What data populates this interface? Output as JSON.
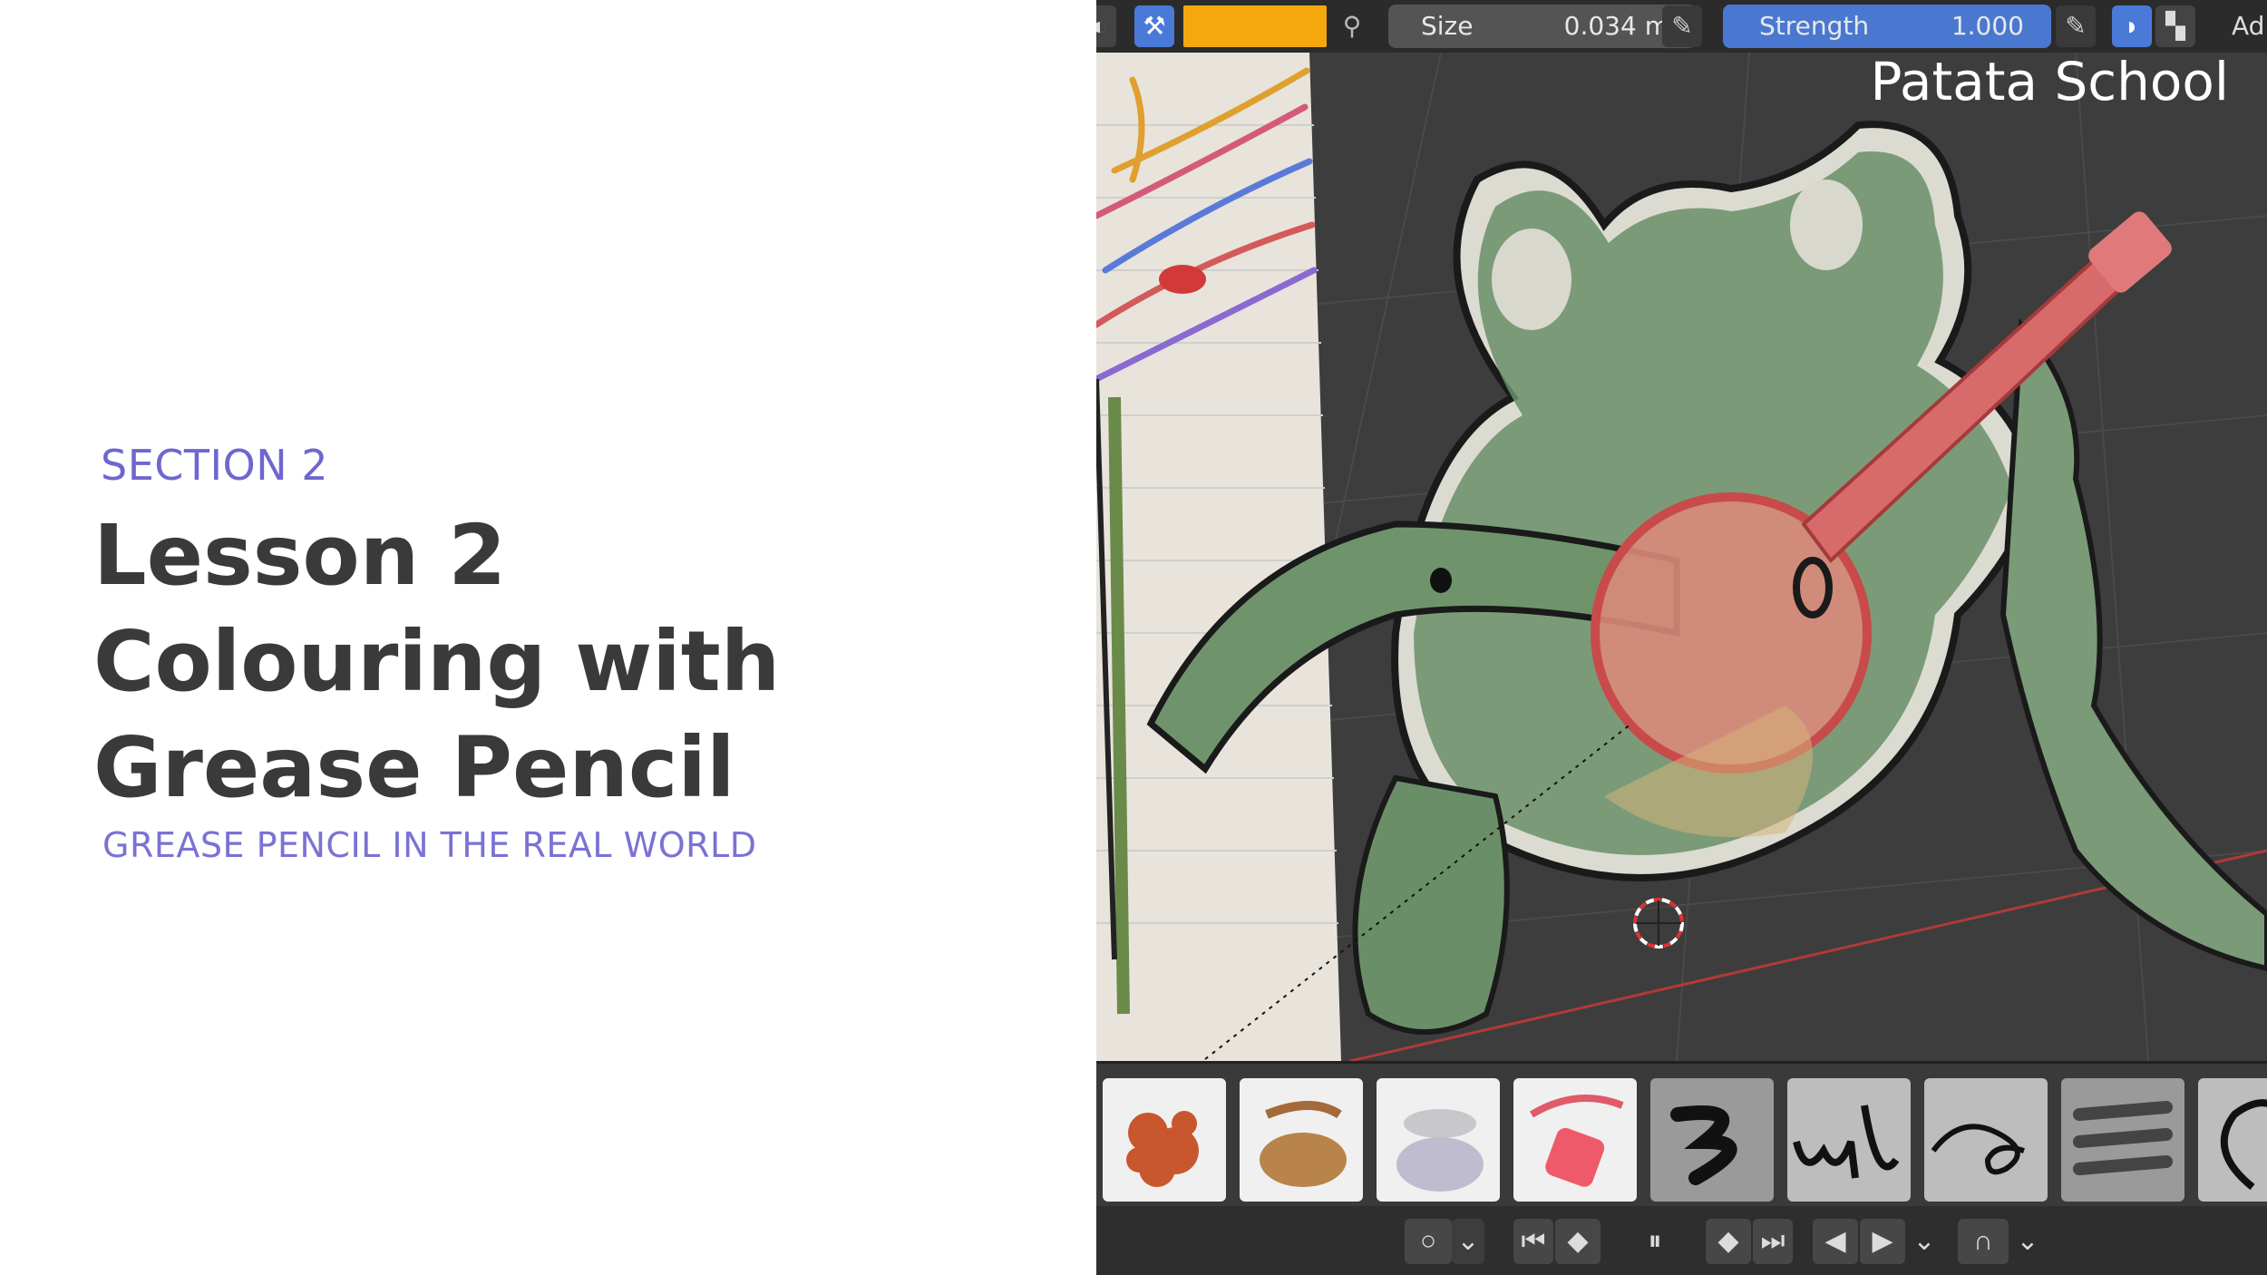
{
  "slide": {
    "section_label": "SECTION 2",
    "title_lines": [
      "Lesson 2",
      "Colouring with",
      "Grease Pencil"
    ],
    "subtitle": "GREASE PENCIL IN THE REAL WORLD"
  },
  "header": {
    "size_label": "Size",
    "size_value": "0.034 m",
    "strength_label": "Strength",
    "strength_value": "1.000",
    "truncated_label": "Ad",
    "active_color": "#f5a80e"
  },
  "watermark": "Patata School",
  "brushes": [
    {
      "name": "texture-orange"
    },
    {
      "name": "marker-brown"
    },
    {
      "name": "airbrush-grey"
    },
    {
      "name": "ink-red"
    },
    {
      "name": "ink-pen-black"
    },
    {
      "name": "pencil-script"
    },
    {
      "name": "scribble-black"
    },
    {
      "name": "marker-stripes"
    },
    {
      "name": "loop-partial"
    }
  ],
  "colors": {
    "accent": "#6e67cf",
    "title": "#3a3a3a",
    "strength_field": "#4a78d0",
    "viewport_bg": "#3d3d3d"
  }
}
